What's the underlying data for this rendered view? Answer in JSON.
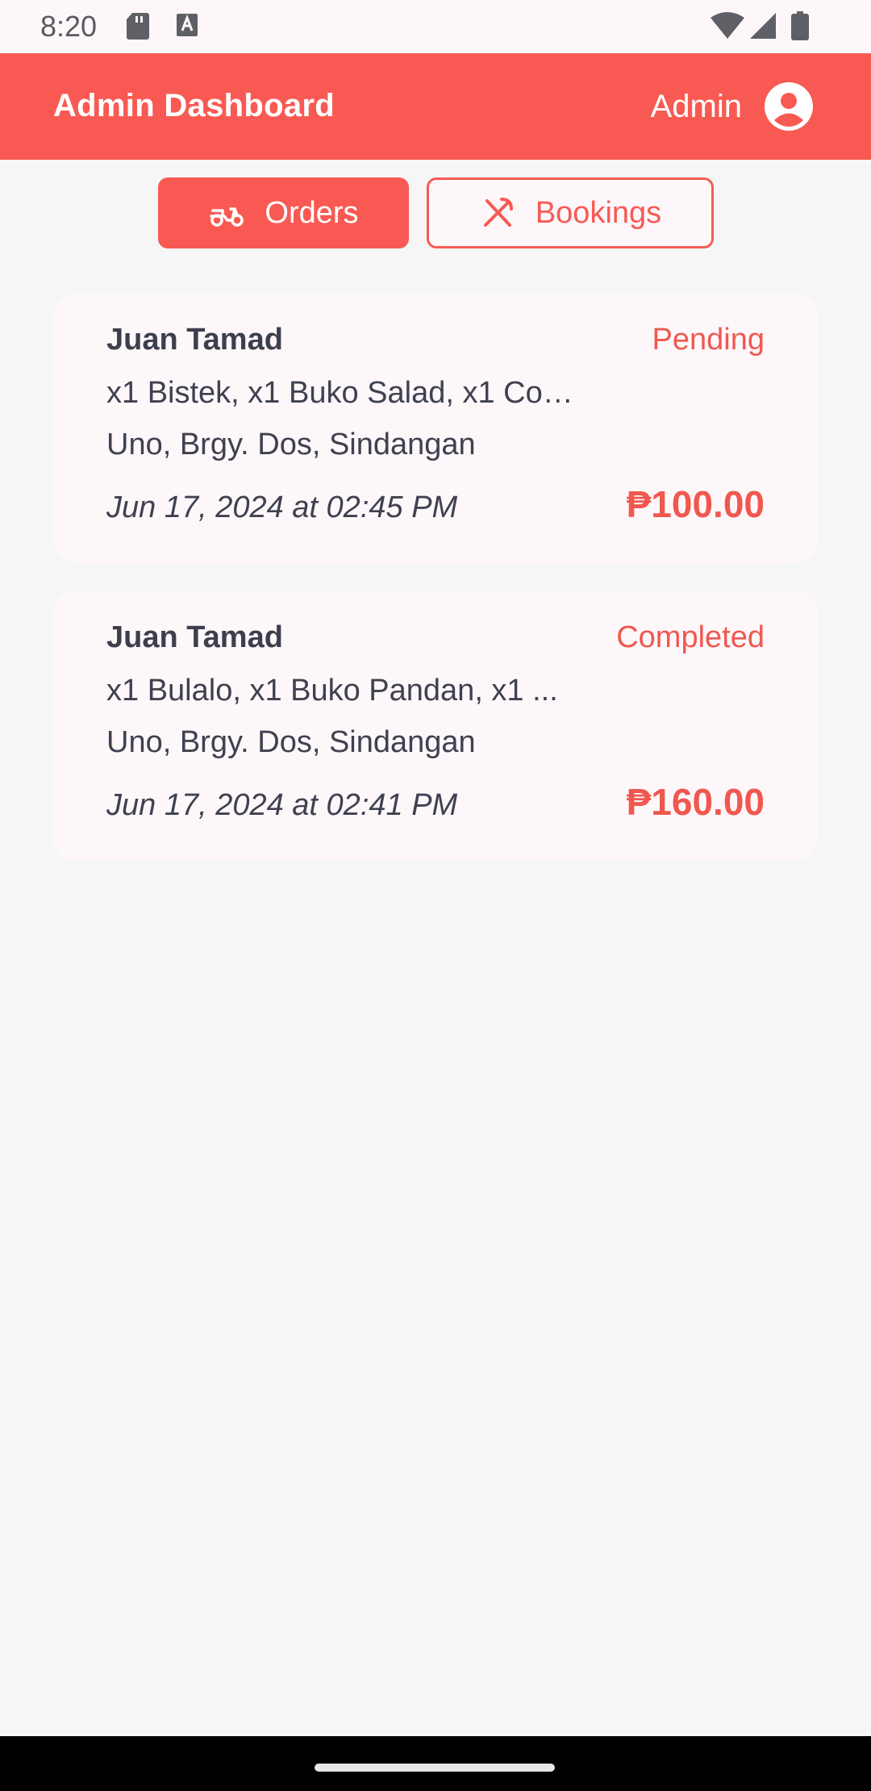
{
  "status_bar": {
    "time": "8:20",
    "icons": [
      "sd-card-icon",
      "keyboard-a-icon",
      "wifi-icon",
      "signal-icon",
      "battery-icon"
    ]
  },
  "app_bar": {
    "title": "Admin Dashboard",
    "user_label": "Admin",
    "color": "#f85a53"
  },
  "tabs": [
    {
      "label": "Orders",
      "icon": "scooter-icon",
      "active": true
    },
    {
      "label": "Bookings",
      "icon": "utensils-crossed-icon",
      "active": false
    }
  ],
  "orders": [
    {
      "customer": "Juan Tamad",
      "status": "Pending",
      "items": "x1 Bistek, x1 Buko Salad, x1 Coke",
      "address": "Uno, Brgy. Dos, Sindangan",
      "datetime": "Jun 17, 2024 at 02:45 PM",
      "total": "₱100.00"
    },
    {
      "customer": "Juan Tamad",
      "status": "Completed",
      "items": "x1 Bulalo, x1 Buko Pandan, x1 ...",
      "address": "Uno, Brgy. Dos, Sindangan",
      "datetime": "Jun 17, 2024 at 02:41 PM",
      "total": "₱160.00"
    }
  ],
  "colors": {
    "accent": "#f85a53",
    "background": "#f6f6f6",
    "card": "#fdf7fa",
    "text": "#3f4150"
  }
}
